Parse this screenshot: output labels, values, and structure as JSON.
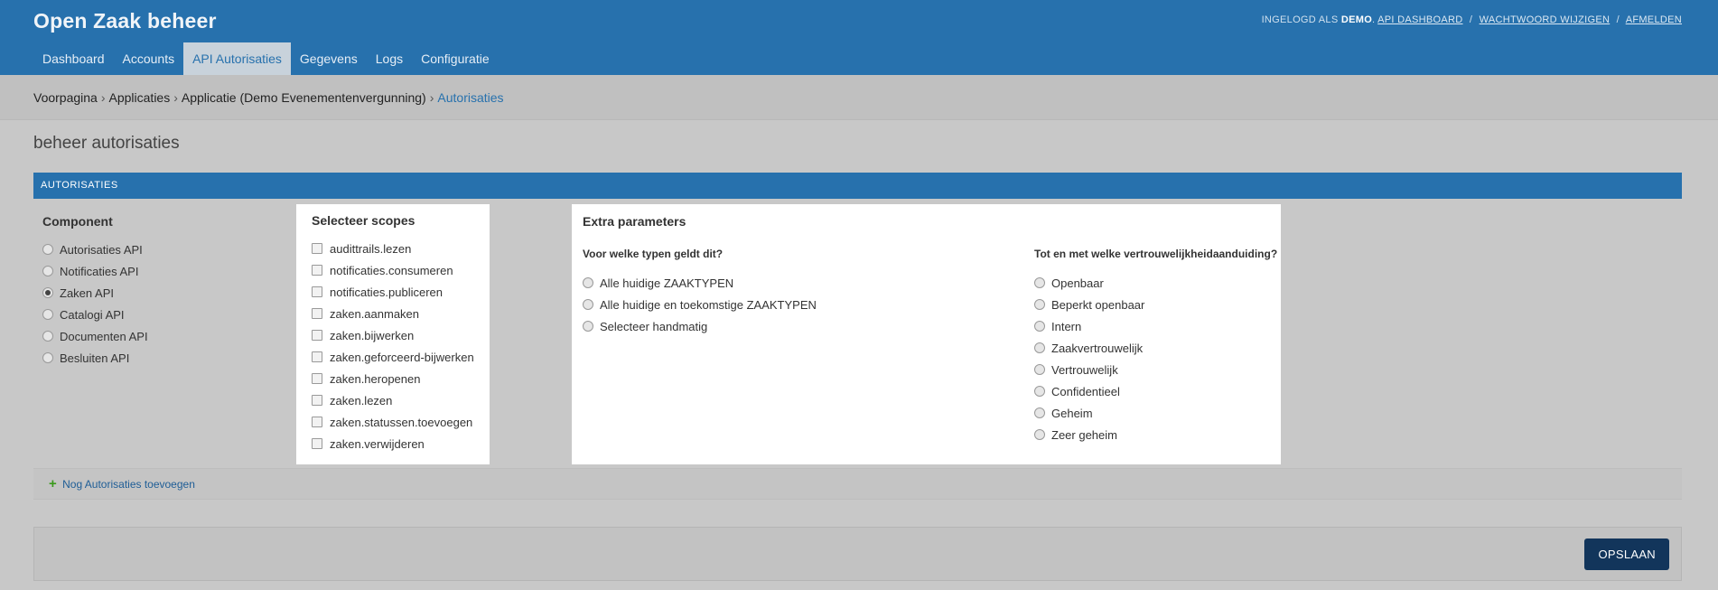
{
  "header": {
    "title": "Open Zaak beheer",
    "user_tools": {
      "logged_in_prefix": "INGELOGD ALS",
      "username": "DEMO",
      "api_dashboard": "API DASHBOARD",
      "change_password": "WACHTWOORD WIJZIGEN",
      "logout": "AFMELDEN",
      "separator": "/"
    },
    "nav": [
      {
        "label": "Dashboard"
      },
      {
        "label": "Accounts"
      },
      {
        "label": "API Autorisaties",
        "active": true
      },
      {
        "label": "Gegevens"
      },
      {
        "label": "Logs"
      },
      {
        "label": "Configuratie"
      }
    ]
  },
  "breadcrumbs": {
    "items": [
      "Voorpagina",
      "Applicaties",
      "Applicatie (Demo Evenementenvergunning)"
    ],
    "current": "Autorisaties",
    "separator": "›"
  },
  "page_title": "beheer autorisaties",
  "section_title": "AUTORISATIES",
  "component": {
    "heading": "Component",
    "options": [
      "Autorisaties API",
      "Notificaties API",
      "Zaken API",
      "Catalogi API",
      "Documenten API",
      "Besluiten API"
    ],
    "selected": "Zaken API"
  },
  "scopes": {
    "heading": "Selecteer scopes",
    "items": [
      "audittrails.lezen",
      "notificaties.consumeren",
      "notificaties.publiceren",
      "zaken.aanmaken",
      "zaken.bijwerken",
      "zaken.geforceerd-bijwerken",
      "zaken.heropenen",
      "zaken.lezen",
      "zaken.statussen.toevoegen",
      "zaken.verwijderen"
    ]
  },
  "extra": {
    "heading": "Extra parameters",
    "types_question": "Voor welke typen geldt dit?",
    "types_options": [
      "Alle huidige ZAAKTYPEN",
      "Alle huidige en toekomstige ZAAKTYPEN",
      "Selecteer handmatig"
    ],
    "conf_question": "Tot en met welke vertrouwelijkheidaanduiding?",
    "conf_options": [
      "Openbaar",
      "Beperkt openbaar",
      "Intern",
      "Zaakvertrouwelijk",
      "Vertrouwelijk",
      "Confidentieel",
      "Geheim",
      "Zeer geheim"
    ]
  },
  "add_more": {
    "label": "Nog Autorisaties toevoegen",
    "icon": "plus-icon"
  },
  "save_button": "OPSLAAN",
  "colors": {
    "header": "#2771ad",
    "save": "#12355b",
    "plus": "#3a9a1c"
  }
}
